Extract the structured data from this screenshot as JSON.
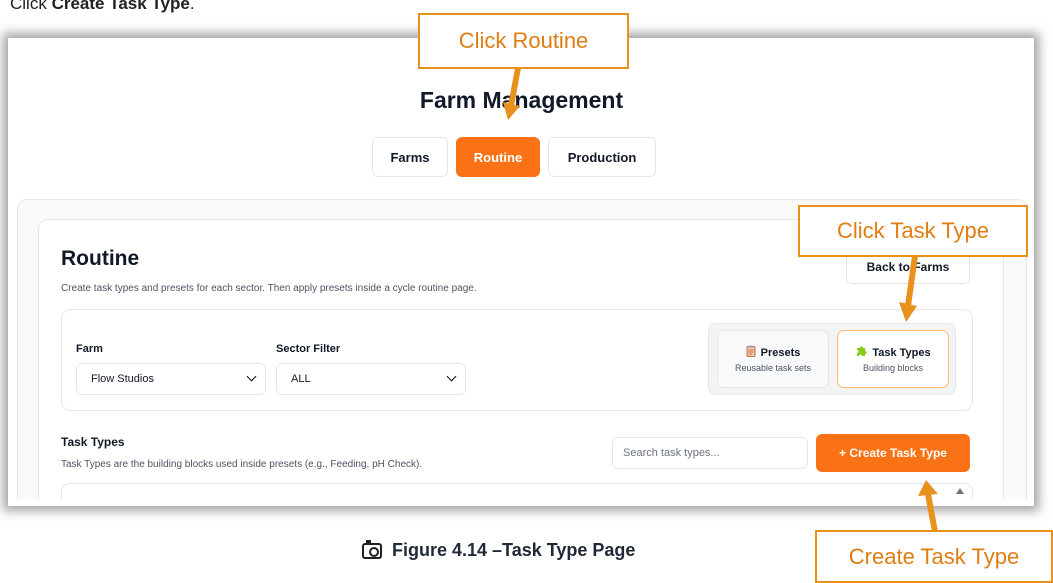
{
  "intro": {
    "prefix": "Click ",
    "bold": "Create Task Type",
    "suffix": "."
  },
  "app": {
    "title": "Farm Management"
  },
  "tabs": [
    {
      "label": "Farms",
      "active": false
    },
    {
      "label": "Routine",
      "active": true
    },
    {
      "label": "Production",
      "active": false
    }
  ],
  "page": {
    "heading": "Routine",
    "subtitle": "Create task types and presets for each sector. Then apply presets inside a cycle routine page.",
    "back_button": "Back to Farms"
  },
  "filters": {
    "farm_label": "Farm",
    "farm_value": "Flow Studios",
    "sector_label": "Sector Filter",
    "sector_value": "ALL"
  },
  "switcher": {
    "presets": {
      "title": "Presets",
      "subtitle": "Reusable task sets",
      "icon": "clipboard-icon"
    },
    "task_types": {
      "title": "Task Types",
      "subtitle": "Building blocks",
      "icon": "puzzle-icon"
    }
  },
  "task_types": {
    "heading": "Task Types",
    "subtitle": "Task Types are the building blocks used inside presets (e.g., Feeding, pH Check).",
    "search_placeholder": "Search task types...",
    "create_button": "+ Create Task Type"
  },
  "callouts": {
    "routine": "Click Routine",
    "task_type": "Click Task Type",
    "create": "Create Task Type"
  },
  "caption": {
    "text": "Figure 4.14 –Task Type Page",
    "icon": "camera-icon"
  },
  "colors": {
    "accent": "#f97316",
    "callout": "#e8911c"
  }
}
